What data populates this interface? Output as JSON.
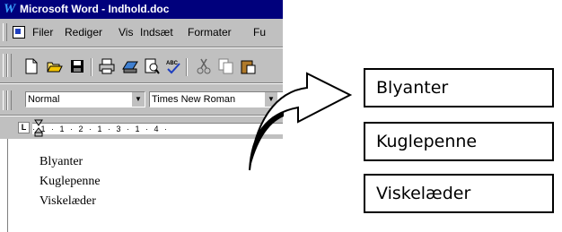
{
  "window": {
    "title": "Microsoft Word - Indhold.doc",
    "logo_glyph": "W"
  },
  "menubar": {
    "items": [
      "Filer",
      "Rediger",
      "Vis",
      "Indsæt",
      "Formater",
      "Fu"
    ]
  },
  "toolbar": {
    "buttons": [
      "new-document-icon",
      "open-folder-icon",
      "save-icon",
      "print-icon",
      "web-preview-icon",
      "print-preview-icon",
      "spelling-icon",
      "cut-icon",
      "copy-icon",
      "paste-icon"
    ]
  },
  "formatting": {
    "style": "Normal",
    "font": "Times New Roman"
  },
  "ruler": {
    "tab_glyph": "L",
    "scale": "· 1 · 1 · 2 · 1 · 3 · 1 · 4 ·"
  },
  "document": {
    "lines": [
      "Blyanter",
      "Kuglepenne",
      "Viskelæder"
    ]
  },
  "result_boxes": [
    "Blyanter",
    "Kuglepenne",
    "Viskelæder"
  ]
}
